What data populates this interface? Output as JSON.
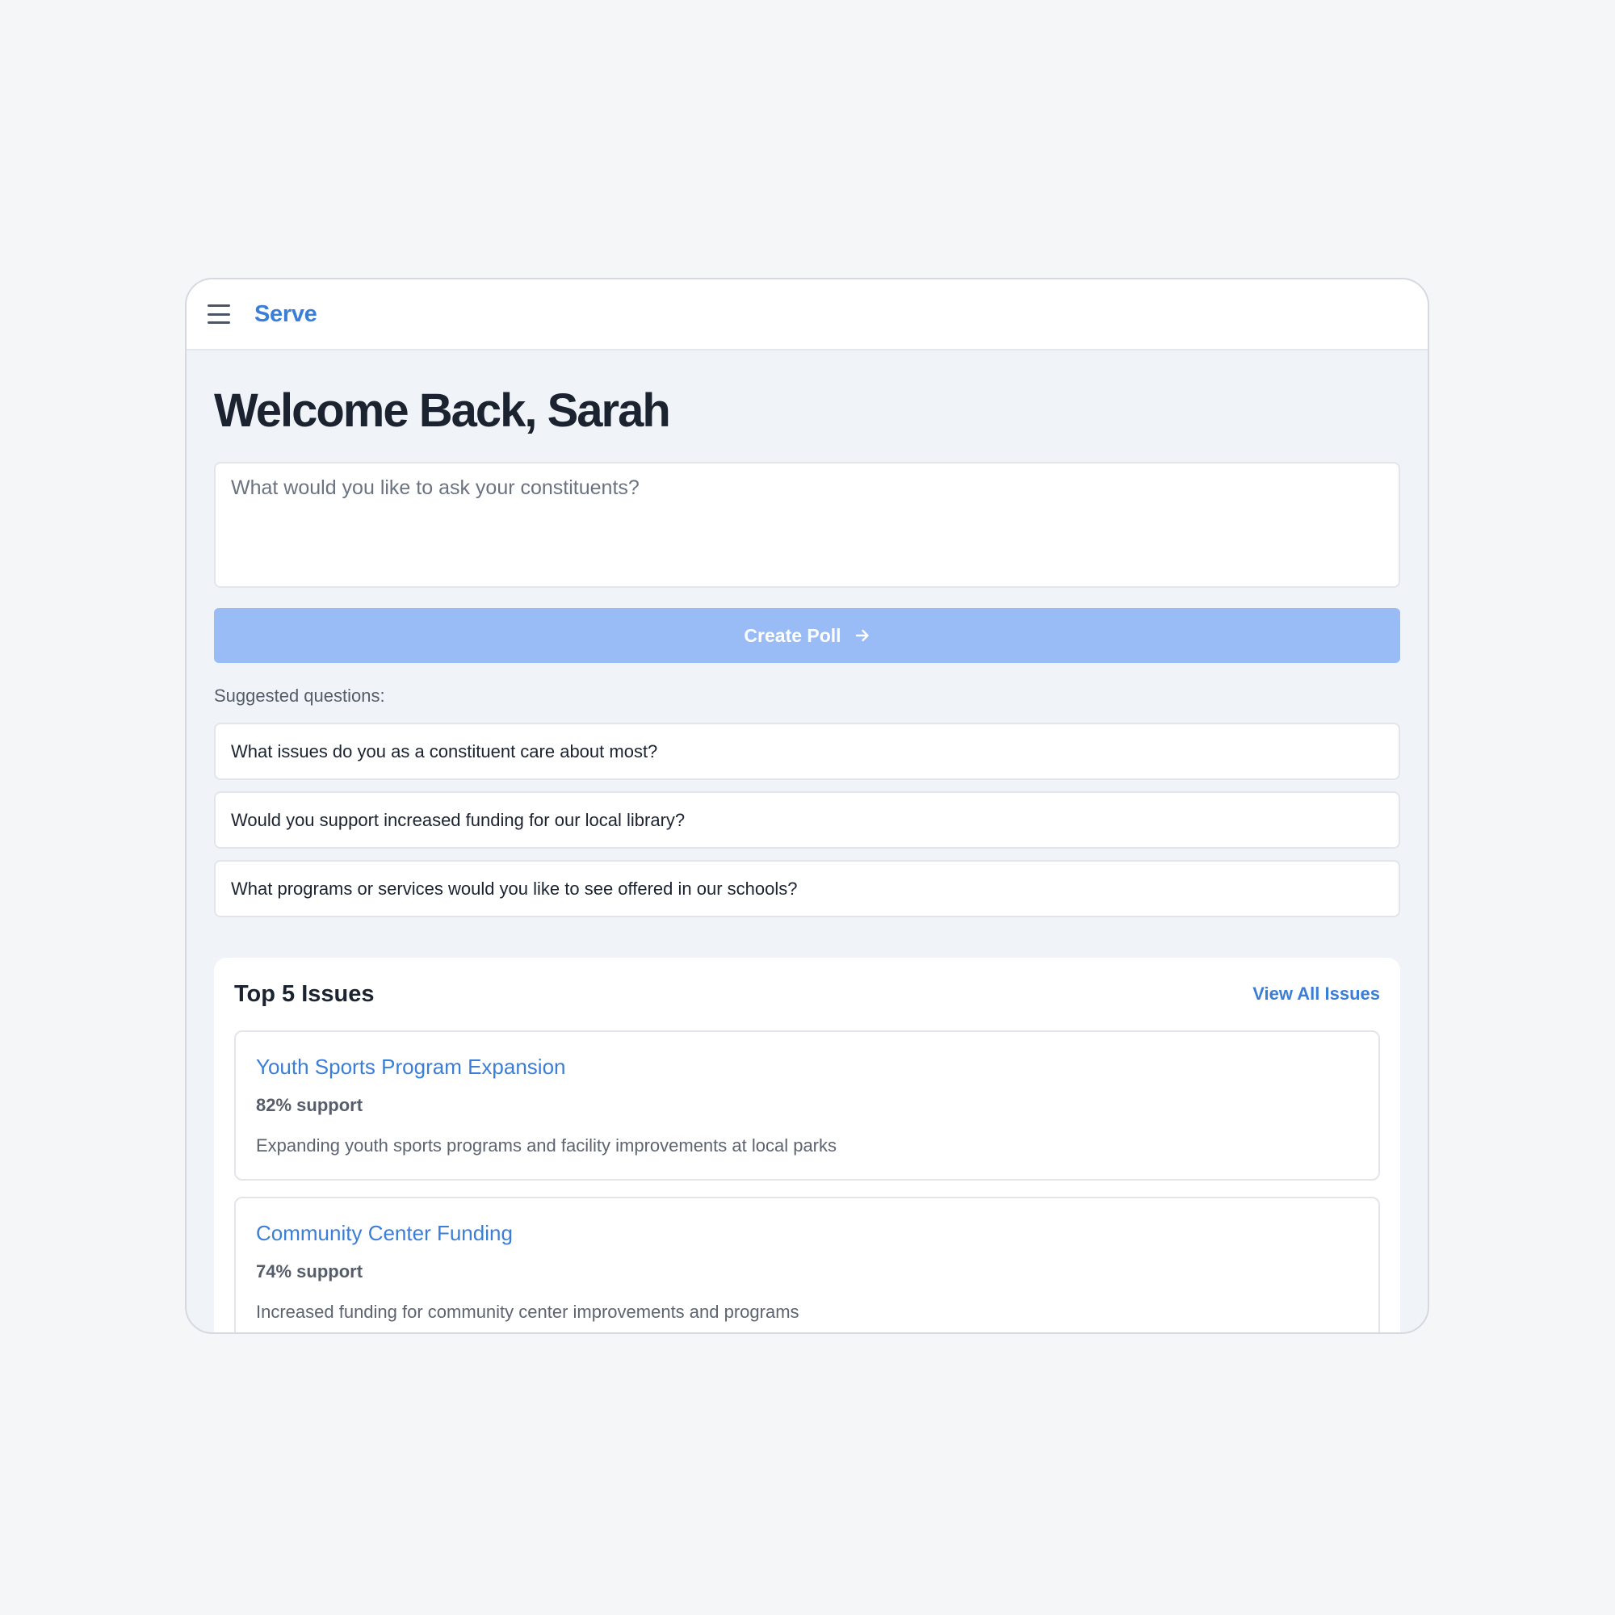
{
  "header": {
    "brand": "Serve"
  },
  "main": {
    "welcome": "Welcome Back, Sarah",
    "ask_placeholder": "What would you like to ask your constituents?",
    "create_poll_label": "Create Poll",
    "suggested_label": "Suggested questions:",
    "suggestions": [
      "What issues do you as a constituent care about most?",
      "Would you support increased funding for our local library?",
      "What programs or services would you like to see offered in our schools?"
    ]
  },
  "issues": {
    "title": "Top 5 Issues",
    "view_all_label": "View All Issues",
    "items": [
      {
        "title": "Youth Sports Program Expansion",
        "support": "82% support",
        "description": "Expanding youth sports programs and facility improvements at local parks"
      },
      {
        "title": "Community Center Funding",
        "support": "74% support",
        "description": "Increased funding for community center improvements and programs"
      }
    ]
  },
  "colors": {
    "brand": "#3b7ed8",
    "button": "#99bcf6",
    "background": "#f0f4f8"
  },
  "icons": [
    "menu-icon",
    "arrow-right-icon"
  ]
}
